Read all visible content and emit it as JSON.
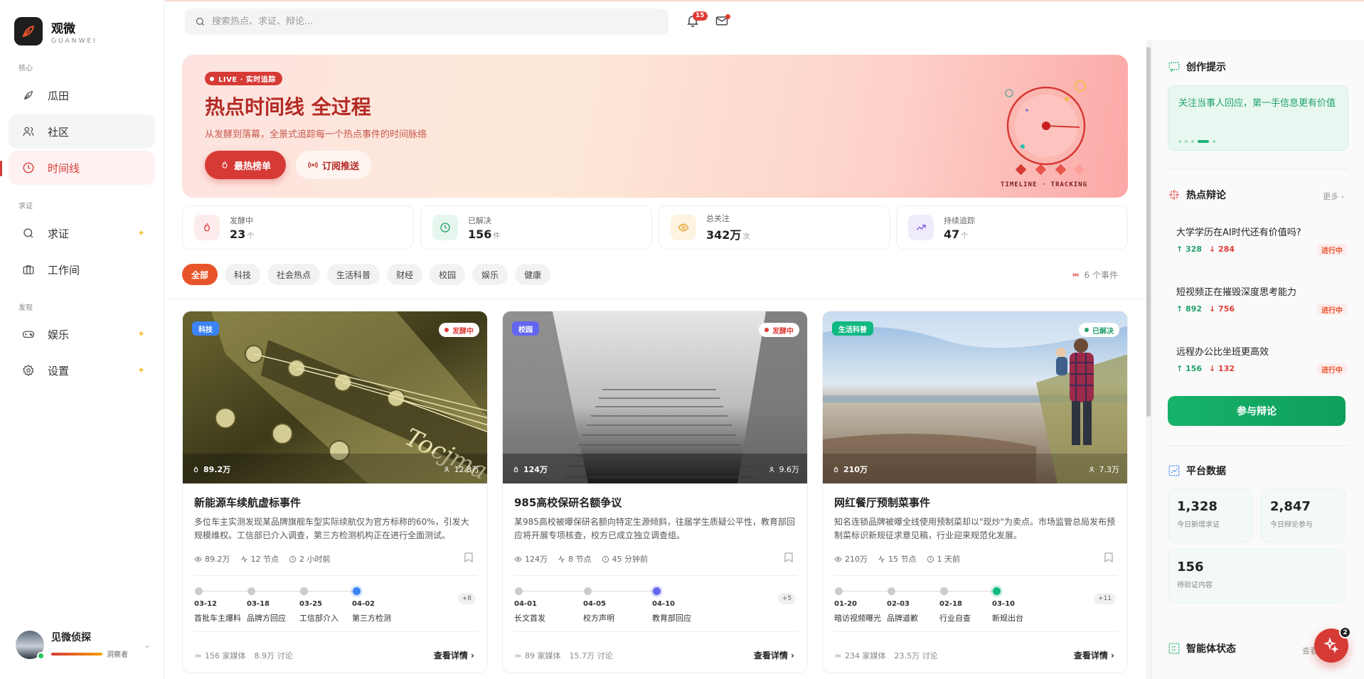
{
  "brand": {
    "name": "观微",
    "sub": "GUANWEI"
  },
  "sidebar": {
    "sections": [
      "核心",
      "求证",
      "发现"
    ],
    "items": [
      {
        "label": "瓜田",
        "icon": "leaf-icon"
      },
      {
        "label": "社区",
        "icon": "users-icon"
      },
      {
        "label": "时间线",
        "icon": "clock-icon"
      },
      {
        "label": "求证",
        "icon": "search-icon"
      },
      {
        "label": "工作间",
        "icon": "briefcase-icon"
      },
      {
        "label": "娱乐",
        "icon": "gamepad-icon"
      },
      {
        "label": "设置",
        "icon": "gear-icon"
      }
    ],
    "sparkle": "✦"
  },
  "user": {
    "name": "见微侦探",
    "level": "洞察者",
    "level_progress": 0.7
  },
  "topbar": {
    "search_placeholder": "搜索热点、求证、辩论...",
    "notif_count": "15"
  },
  "hero": {
    "live": "LIVE · 实时追踪",
    "title": "热点时间线 全过程",
    "subtitle": "从发酵到落幕，全景式追踪每一个热点事件的时间脉络",
    "btn_hot": "最热榜单",
    "btn_sub": "订阅推送",
    "art_label": "TIMELINE · TRACKING"
  },
  "stats": [
    {
      "label": "发酵中",
      "value": "23",
      "unit": "个",
      "color": "#e03b35"
    },
    {
      "label": "已解决",
      "value": "156",
      "unit": "件",
      "color": "#22a06b"
    },
    {
      "label": "总关注",
      "value": "342万",
      "unit": "次",
      "color": "#e8a020"
    },
    {
      "label": "持续追踪",
      "value": "47",
      "unit": "个",
      "color": "#7c5ce0"
    }
  ],
  "filters": [
    "全部",
    "科技",
    "社会热点",
    "生活科普",
    "财经",
    "校园",
    "娱乐",
    "健康"
  ],
  "event_count": "6 个事件",
  "cards": [
    {
      "tag": "科技",
      "tag_color": "#3b82f6",
      "status": "发酵中",
      "status_color": "#e03b35",
      "heat": "89.2万",
      "people": "12.8万",
      "title": "新能源车续航虚标事件",
      "desc": "多位车主实测发现某品牌旗舰车型实际续航仅为官方标称的60%，引发大规模维权。工信部已介入调查，第三方检测机构正在进行全面测试。",
      "views": "89.2万",
      "nodes": "12 节点",
      "time": "2 小时前",
      "timeline": [
        {
          "date": "03-12",
          "label": "首批车主爆料"
        },
        {
          "date": "03-18",
          "label": "品牌方回应"
        },
        {
          "date": "03-25",
          "label": "工信部介入"
        },
        {
          "date": "04-02",
          "label": "第三方检测"
        }
      ],
      "more": "+8",
      "current_color": "#3b82f6",
      "media": "156 家媒体",
      "discuss": "8.9万 讨论",
      "detail": "查看详情"
    },
    {
      "tag": "校园",
      "tag_color": "#6366f1",
      "status": "发酵中",
      "status_color": "#e03b35",
      "heat": "124万",
      "people": "9.6万",
      "title": "985高校保研名额争议",
      "desc": "某985高校被曝保研名额向特定生源倾斜，往届学生质疑公平性，教育部回应将开展专项核查，校方已成立独立调查组。",
      "views": "124万",
      "nodes": "8 节点",
      "time": "45 分钟前",
      "timeline": [
        {
          "date": "04-01",
          "label": "长文首发"
        },
        {
          "date": "04-05",
          "label": "校方声明"
        },
        {
          "date": "04-10",
          "label": "教育部回应"
        }
      ],
      "more": "+5",
      "current_color": "#6366f1",
      "media": "89 家媒体",
      "discuss": "15.7万 讨论",
      "detail": "查看详情"
    },
    {
      "tag": "生活科普",
      "tag_color": "#10b981",
      "status": "已解决",
      "status_color": "#22a06b",
      "heat": "210万",
      "people": "7.3万",
      "title": "网红餐厅预制菜事件",
      "desc": "知名连锁品牌被曝全线使用预制菜却以\"现炒\"为卖点。市场监管总局发布预制菜标识新规征求意见稿，行业迎来规范化发展。",
      "views": "210万",
      "nodes": "15 节点",
      "time": "1 天前",
      "timeline": [
        {
          "date": "01-20",
          "label": "暗访视频曝光"
        },
        {
          "date": "02-03",
          "label": "品牌道歉"
        },
        {
          "date": "02-18",
          "label": "行业自查"
        },
        {
          "date": "03-10",
          "label": "新规出台"
        }
      ],
      "more": "+11",
      "current_color": "#10b981",
      "media": "234 家媒体",
      "discuss": "23.5万 讨论",
      "detail": "查看详情"
    }
  ],
  "right": {
    "tip_title": "创作提示",
    "tip_text": "关注当事人回应，第一手信息更有价值",
    "debate_title": "热点辩论",
    "debate_more": "更多 ›",
    "debates": [
      {
        "title": "大学学历在AI时代还有价值吗?",
        "up": "↑ 328",
        "down": "↓ 284",
        "status": "进行中"
      },
      {
        "title": "短视频正在摧毁深度思考能力",
        "up": "↑ 892",
        "down": "↓ 756",
        "status": "进行中"
      },
      {
        "title": "远程办公比坐班更高效",
        "up": "↑ 156",
        "down": "↓ 132",
        "status": "进行中"
      }
    ],
    "join": "参与辩论",
    "platform_title": "平台数据",
    "platform": [
      {
        "value": "1,328",
        "label": "今日新增求证"
      },
      {
        "value": "2,847",
        "label": "今日辩论参与"
      },
      {
        "value": "156",
        "label": "待验证内容"
      }
    ],
    "agent_title": "智能体状态",
    "agent_more": "查看",
    "fab_count": "2"
  },
  "colors": {
    "accent": "#d63a35",
    "green": "#17b26a"
  }
}
